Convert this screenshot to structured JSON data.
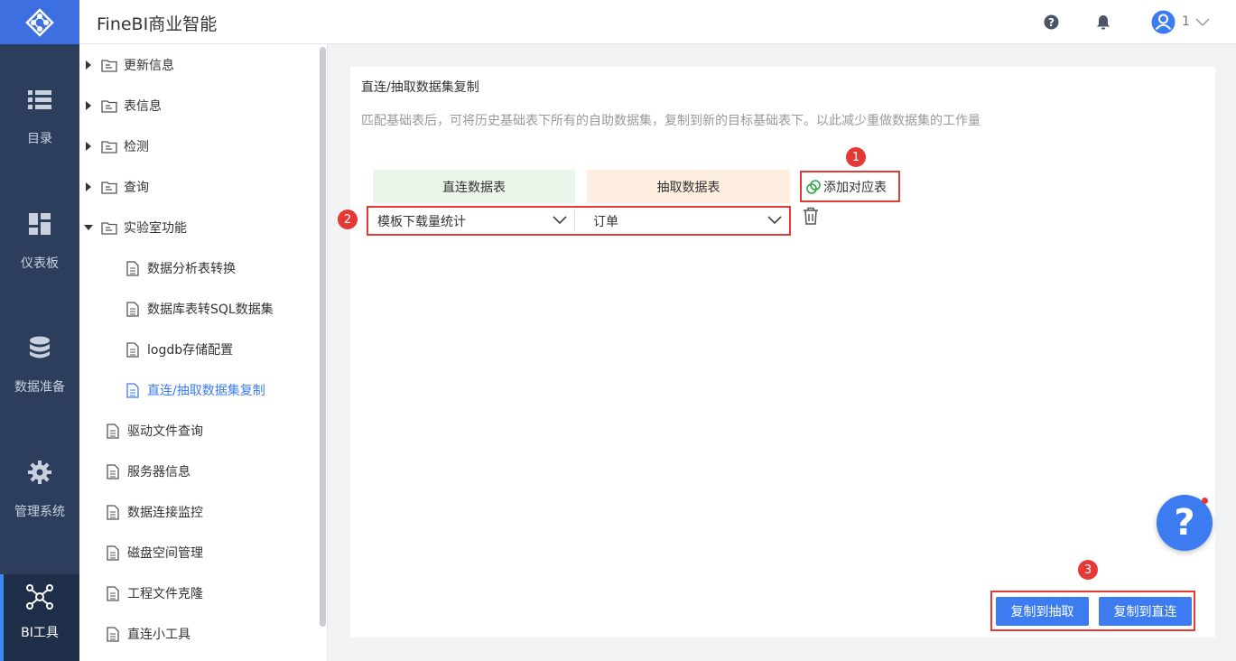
{
  "app": {
    "title": "FineBI商业智能",
    "user_count": "1"
  },
  "leftnav": [
    {
      "label": "目录",
      "icon": "list-icon"
    },
    {
      "label": "仪表板",
      "icon": "dashboard-icon"
    },
    {
      "label": "数据准备",
      "icon": "database-icon"
    },
    {
      "label": "管理系统",
      "icon": "gear-icon"
    },
    {
      "label": "BI工具",
      "icon": "network-icon",
      "active": true
    }
  ],
  "tree": {
    "items": [
      {
        "label": "更新信息",
        "type": "folder",
        "expanded": false
      },
      {
        "label": "表信息",
        "type": "folder",
        "expanded": false
      },
      {
        "label": "检测",
        "type": "folder",
        "expanded": false
      },
      {
        "label": "查询",
        "type": "folder",
        "expanded": false
      },
      {
        "label": "实验室功能",
        "type": "folder",
        "expanded": true
      },
      {
        "label": "数据分析表转换",
        "type": "file",
        "level": 2
      },
      {
        "label": "数据库表转SQL数据集",
        "type": "file",
        "level": 2
      },
      {
        "label": "logdb存储配置",
        "type": "file",
        "level": 2
      },
      {
        "label": "直连/抽取数据集复制",
        "type": "file",
        "level": 2,
        "active": true
      },
      {
        "label": "驱动文件查询",
        "type": "file",
        "level": 1
      },
      {
        "label": "服务器信息",
        "type": "file",
        "level": 1
      },
      {
        "label": "数据连接监控",
        "type": "file",
        "level": 1
      },
      {
        "label": "磁盘空间管理",
        "type": "file",
        "level": 1
      },
      {
        "label": "工程文件克隆",
        "type": "file",
        "level": 1
      },
      {
        "label": "直连小工具",
        "type": "file",
        "level": 1
      }
    ]
  },
  "main": {
    "title": "直连/抽取数据集复制",
    "description": "匹配基础表后，可将历史基础表下所有的自助数据集，复制到新的目标基础表下。以此减少重做数据集的工作量",
    "col_direct": "直连数据表",
    "col_extract": "抽取数据表",
    "add_label": "添加对应表",
    "direct_select": "模板下载量统计",
    "extract_select": "订单",
    "copy_to_extract": "复制到抽取",
    "copy_to_direct": "复制到直连",
    "badges": [
      "1",
      "2",
      "3"
    ]
  },
  "colors": {
    "accent": "#3d7cf0",
    "sidebar": "#2c3e5c",
    "highlight": "#e53935"
  }
}
